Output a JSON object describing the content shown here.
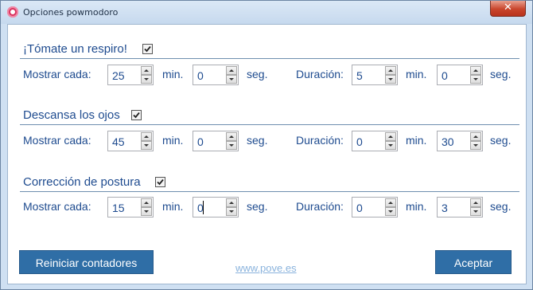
{
  "window": {
    "title": "Opciones powmodoro",
    "close_label": "✕"
  },
  "sections": [
    {
      "title": "¡Tómate un respiro!",
      "checked": true,
      "show_label": "Mostrar cada:",
      "show_min": "25",
      "min_unit": "min.",
      "show_sec": "0",
      "sec_unit": "seg.",
      "duration_label": "Duración:",
      "dur_min": "5",
      "dur_sec": "0"
    },
    {
      "title": "Descansa los ojos",
      "checked": true,
      "show_label": "Mostrar cada:",
      "show_min": "45",
      "min_unit": "min.",
      "show_sec": "0",
      "sec_unit": "seg.",
      "duration_label": "Duración:",
      "dur_min": "0",
      "dur_sec": "30"
    },
    {
      "title": "Corrección de postura",
      "checked": true,
      "show_label": "Mostrar cada:",
      "show_min": "15",
      "min_unit": "min.",
      "show_sec": "0",
      "sec_unit": "seg.",
      "duration_label": "Duración:",
      "dur_min": "0",
      "dur_sec": "3"
    }
  ],
  "footer": {
    "reset_label": "Reiniciar contadores",
    "link_text": "www.pove.es",
    "accept_label": "Aceptar"
  },
  "colors": {
    "accent": "#2f6ea6",
    "text": "#1e4b8f",
    "link": "#8ab3dd"
  }
}
